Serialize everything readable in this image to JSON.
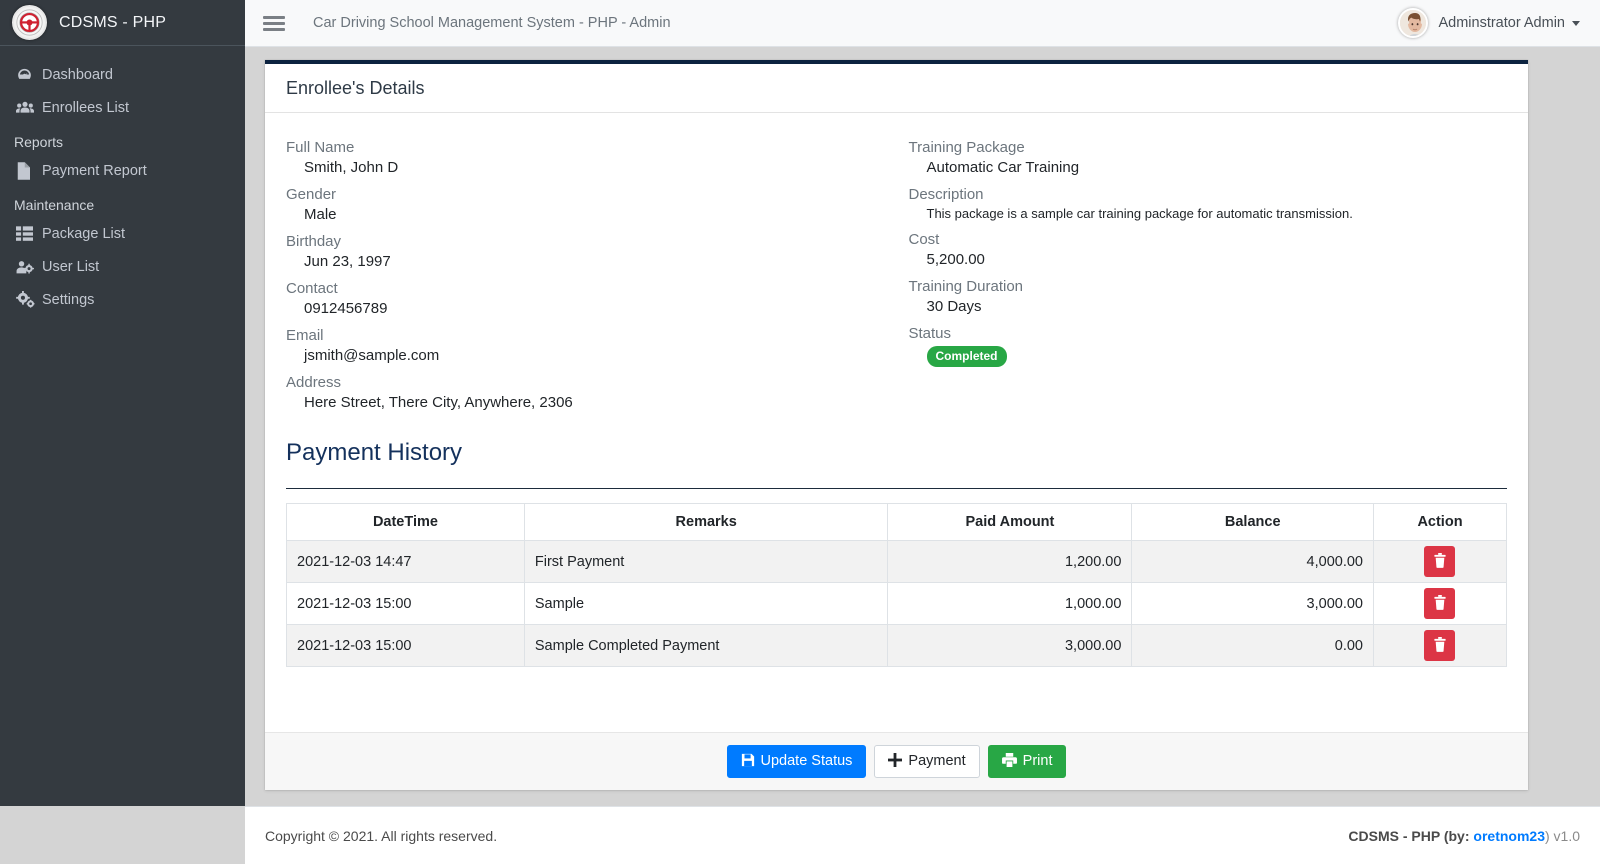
{
  "brand": {
    "name": "CDSMS - PHP",
    "logo_icon": "steering-wheel-logo"
  },
  "sidebar": {
    "items": [
      {
        "label": "Dashboard",
        "icon": "tachometer-icon"
      },
      {
        "label": "Enrollees List",
        "icon": "users-icon"
      }
    ],
    "sections": [
      {
        "header": "Reports",
        "items": [
          {
            "label": "Payment Report",
            "icon": "file-icon"
          }
        ]
      },
      {
        "header": "Maintenance",
        "items": [
          {
            "label": "Package List",
            "icon": "table-list-icon"
          },
          {
            "label": "User List",
            "icon": "users-cog-icon"
          },
          {
            "label": "Settings",
            "icon": "cogs-icon"
          }
        ]
      }
    ]
  },
  "topbar": {
    "menu_icon": "hamburger-icon",
    "title": "Car Driving School Management System - PHP - Admin",
    "user_name": "Adminstrator Admin",
    "avatar_icon": "user-avatar",
    "caret_icon": "caret-down-icon"
  },
  "card": {
    "title": "Enrollee's Details",
    "accent_color": "#0c2340",
    "left_fields": [
      {
        "label": "Full Name",
        "value": "Smith, John D"
      },
      {
        "label": "Gender",
        "value": "Male"
      },
      {
        "label": "Birthday",
        "value": "Jun 23, 1997"
      },
      {
        "label": "Contact",
        "value": "0912456789"
      },
      {
        "label": "Email",
        "value": "jsmith@sample.com"
      },
      {
        "label": "Address",
        "value": "Here Street, There City, Anywhere, 2306"
      }
    ],
    "right_fields": [
      {
        "label": "Training Package",
        "value": "Automatic Car Training"
      },
      {
        "label": "Description",
        "value": "This package is a sample car training package for automatic transmission.",
        "small": true
      },
      {
        "label": "Cost",
        "value": "5,200.00"
      },
      {
        "label": "Training Duration",
        "value": "30 Days"
      }
    ],
    "status_label": "Status",
    "status_value": "Completed",
    "status_color": "#28a745"
  },
  "payment_history": {
    "title": "Payment History",
    "columns": [
      "DateTime",
      "Remarks",
      "Paid Amount",
      "Balance",
      "Action"
    ],
    "rows": [
      {
        "datetime": "2021-12-03 14:47",
        "remarks": "First Payment",
        "paid": "1,200.00",
        "balance": "4,000.00",
        "action_icon": "trash-icon"
      },
      {
        "datetime": "2021-12-03 15:00",
        "remarks": "Sample",
        "paid": "1,000.00",
        "balance": "3,000.00",
        "action_icon": "trash-icon"
      },
      {
        "datetime": "2021-12-03 15:00",
        "remarks": "Sample Completed Payment",
        "paid": "3,000.00",
        "balance": "0.00",
        "action_icon": "trash-icon"
      }
    ],
    "delete_color": "#dc3545"
  },
  "actions": {
    "update_status": {
      "label": "Update Status",
      "icon": "save-icon",
      "color": "#007bff"
    },
    "payment": {
      "label": "Payment",
      "icon": "plus-icon"
    },
    "print": {
      "label": "Print",
      "icon": "printer-icon",
      "color": "#28a745"
    }
  },
  "footer": {
    "copyright": "Copyright © 2021. All rights reserved.",
    "app": "CDSMS - PHP (by:",
    "author": "oretnom23",
    "version": ") v1.0"
  }
}
